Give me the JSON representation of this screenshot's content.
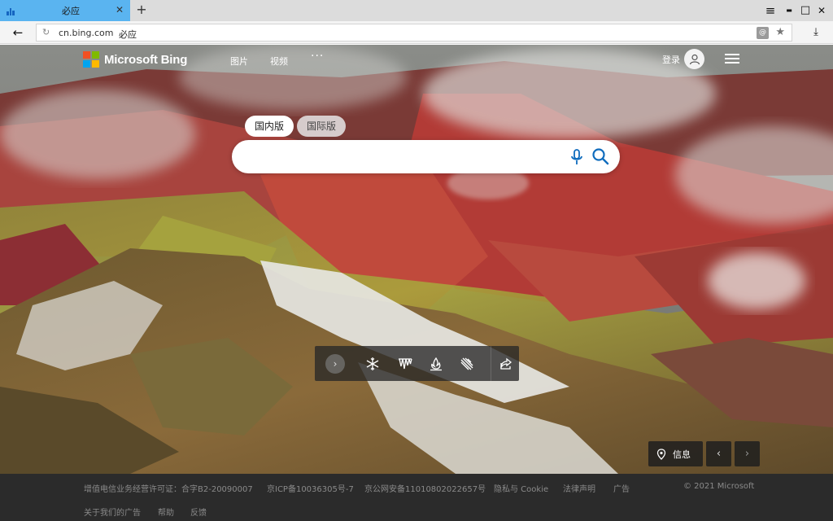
{
  "browser": {
    "tab_title": "必应",
    "tab_close": "✕",
    "new_tab": "+",
    "back": "←",
    "reload": "↻",
    "url": "cn.bing.com",
    "page_title": "必应",
    "ext_icon": "@",
    "star": "★",
    "download": "⤓",
    "menu": "≡",
    "minimize": "▬",
    "maximize": "□",
    "close": "✕",
    "tab_accent": "#5ab4f0"
  },
  "header": {
    "logo_text": "Microsoft Bing",
    "nav": [
      "图片",
      "视频"
    ],
    "more": "···",
    "login": "登录"
  },
  "search": {
    "tabs": [
      "国内版",
      "国际版"
    ],
    "active_tab": "国内版",
    "query": "",
    "icons": [
      "microphone-icon",
      "search-icon"
    ]
  },
  "toolbar": {
    "expand": "›",
    "icons": [
      "snowflake-icon",
      "ice-icon",
      "campfire-icon",
      "snowfall-icon",
      "share-icon"
    ]
  },
  "image_nav": {
    "info_label": "信息",
    "prev": "‹",
    "next": "›"
  },
  "footer": {
    "links_row1": [
      "增值电信业务经营许可证：合字B2-20090007",
      "京ICP备10036305号-7",
      "京公网安备11010802022657号",
      "隐私与 Cookie",
      "法律声明",
      "广告"
    ],
    "copyright": "© 2021 Microsoft",
    "links_row2": [
      "关于我们的广告",
      "帮助",
      "反馈"
    ]
  },
  "colors": {
    "ms_red": "#f25022",
    "ms_green": "#7fba00",
    "ms_blue": "#00a4ef",
    "ms_yellow": "#ffb900",
    "bing_blue": "#0f6cbd"
  }
}
